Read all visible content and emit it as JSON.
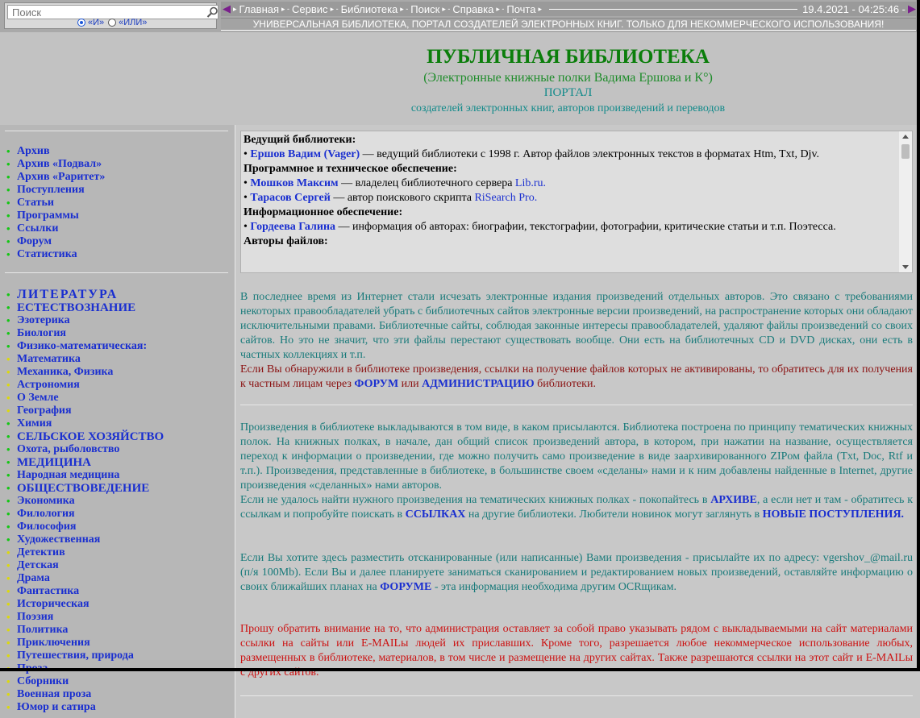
{
  "search": {
    "placeholder": "Поиск",
    "radio_and": "«И»",
    "radio_or": "«ИЛИ»"
  },
  "nav": {
    "items": [
      "Главная",
      "Сервис",
      "Библиотека",
      "Поиск",
      "Справка",
      "Почта"
    ],
    "datetime": "19.4.2021 - 04:25:46 -"
  },
  "tagline": "Универсальная библиотека, портал создателей электронных книг. Только для некоммерческого использования!",
  "header": {
    "title": "ПУБЛИЧНАЯ БИБЛИОТЕКА",
    "subtitle": "(Электронные книжные полки Вадима Ершова и К°)",
    "portal": "ПОРТАЛ",
    "creators": "создателей электронных книг, авторов произведений и переводов"
  },
  "sidebar": {
    "menu1": [
      "Архив",
      "Архив «Подвал»",
      "Архив «Раритет»",
      "Поступления",
      "Статьи",
      "Программы",
      "Ссылки",
      "Форум",
      "Статистика"
    ],
    "literature_label": "ЛИТЕРАТУРА",
    "menu2": [
      {
        "label": "ЕСТЕСТВОЗНАНИЕ",
        "dot": "green",
        "cat": true
      },
      {
        "label": "Эзотерика",
        "dot": "green"
      },
      {
        "label": "Биология",
        "dot": "green"
      },
      {
        "label": "Физико-математическая:",
        "dot": "green"
      },
      {
        "label": "Математика",
        "dot": "yellow"
      },
      {
        "label": "Механика, Физика",
        "dot": "yellow"
      },
      {
        "label": "Астрономия",
        "dot": "yellow"
      },
      {
        "label": "О Земле",
        "dot": "yellow"
      },
      {
        "label": "География",
        "dot": "yellow"
      },
      {
        "label": "Химия",
        "dot": "green"
      },
      {
        "label": "СЕЛЬСКОЕ ХОЗЯЙСТВО",
        "dot": "green",
        "cat": true
      },
      {
        "label": "Охота, рыболовство",
        "dot": "green"
      },
      {
        "label": "МЕДИЦИНА",
        "dot": "green",
        "cat": true
      },
      {
        "label": "Народная медицина",
        "dot": "green"
      },
      {
        "label": "ОБЩЕСТВОВЕДЕНИЕ",
        "dot": "green",
        "cat": true
      },
      {
        "label": "Экономика",
        "dot": "green"
      },
      {
        "label": "Филология",
        "dot": "green"
      },
      {
        "label": "Философия",
        "dot": "green"
      },
      {
        "label": "Художественная",
        "dot": "green"
      },
      {
        "label": "Детектив",
        "dot": "yellow"
      },
      {
        "label": "Детская",
        "dot": "yellow"
      },
      {
        "label": "Драма",
        "dot": "yellow"
      },
      {
        "label": "Фантастика",
        "dot": "yellow"
      },
      {
        "label": "Историческая",
        "dot": "yellow"
      },
      {
        "label": "Поэзия",
        "dot": "yellow"
      },
      {
        "label": "Политика",
        "dot": "yellow"
      },
      {
        "label": "Приключения",
        "dot": "yellow"
      },
      {
        "label": "Путешествия, природа",
        "dot": "yellow"
      },
      {
        "label": "Проза",
        "dot": "yellow"
      },
      {
        "label": "Сборники",
        "dot": "yellow"
      },
      {
        "label": "Военная проза",
        "dot": "yellow"
      },
      {
        "label": "Юмор и сатира",
        "dot": "yellow"
      }
    ]
  },
  "staff": {
    "h_lead": "Ведущий библиотеки:",
    "lead_name": "Ершов Вадим (Vager)",
    "lead_text": " — ведущий библиотеки с 1998 г. Автор файлов электронных текстов в форматах Htm, Txt, Djv.",
    "h_tech": "Программное и техническое обеспечение:",
    "tech1_name": "Мошков Максим",
    "tech1_text": " — владелец библиотечного сервера ",
    "tech1_link": "Lib.ru.",
    "tech2_name": "Тарасов Сергей",
    "tech2_text": " — автор поискового скрипта ",
    "tech2_link": "RiSearch Pro.",
    "h_info": "Информационное обеспечение:",
    "info1_name": "Гордеева Галина",
    "info1_text": " — информация об авторах: биографии, текстографии, фотографии, критические статьи и т.п. Поэтесса.",
    "h_authors": "Авторы файлов:"
  },
  "para1": {
    "text": "В последнее время из Интернет стали исчезать электронные издания произведений отдельных авторов. Это связано с требованиями некоторых правообладателей убрать с библиотечных сайтов электронные версии произведений, на распространение которых они обладают исключительными правами. Библиотечные сайты, соблюдая законные интересы правообладателей, удаляют файлы произведений со своих сайтов. Но это не значит, что эти файлы перестают существовать вообще. Они есть на библиотечных CD и DVD дисках, они есть в частных коллекциях и т.п.",
    "red1": "Если Вы обнаружили в библиотеке произведения, ссылки на получение файлов которых не активированы, то обратитесь для их получения к частным лицам через ",
    "forum": "ФОРУМ",
    "or": " или ",
    "admin": "АДМИНИСТРАЦИЮ",
    "end": " библиотеки."
  },
  "para2": {
    "text": "Произведения в библиотеке выкладываются в том виде, в каком присылаются. Библиотека построена по принципу тематических книжных полок. На книжных полках, в начале, дан общий список произведений автора, в котором, при нажатии на название, осуществляется переход к информации о произведении, где можно получить само произведение в виде заархивированного ZIPом файла (Txt, Doc, Rtf и т.п.). Произведения, представленные в библиотеке, в большинстве своем «сделаны» нами и к ним добавлены найденные в Internet, другие произведения «сделанных» нами авторов.",
    "t2": "Если не удалось найти нужного произведения на тематических книжных полках - покопайтесь в ",
    "archive": "АРХИВЕ",
    "t3": ", а если нет и там - обратитесь к ссылкам и попробуйте поискать в ",
    "links": "ССЫЛКАХ",
    "t4": " на другие библиотеки. Любители новинок могут заглянуть в ",
    "new": "НОВЫЕ ПОСТУПЛЕНИЯ."
  },
  "para3": {
    "t1": "Если Вы хотите здесь разместить отсканированные (или написанные) Вами произведения - присылайте их по адресу: vgershov_@mail.ru (п/я 100Mb). Если Вы и далее планируете заниматься сканированием и редактированием новых произведений, оставляйте информацию о своих ближайших планах на ",
    "forum": "ФОРУМЕ",
    "t2": " - эта информация необходима другим OCRщикам."
  },
  "para4": {
    "text": "Прошу обратить внимание на то, что администрация оставляет за собой право указывать рядом с выкладываемыми на сайт материалами ссылки на сайты или E-MAILы людей их приславших. Кроме того, разрешается любое некоммерческое использование любых, размещенных в библиотеке, материалов, в том числе и размещение на других сайтах. Также разрешаются ссылки на этот сайт и E-MAILы с других сайтов."
  }
}
